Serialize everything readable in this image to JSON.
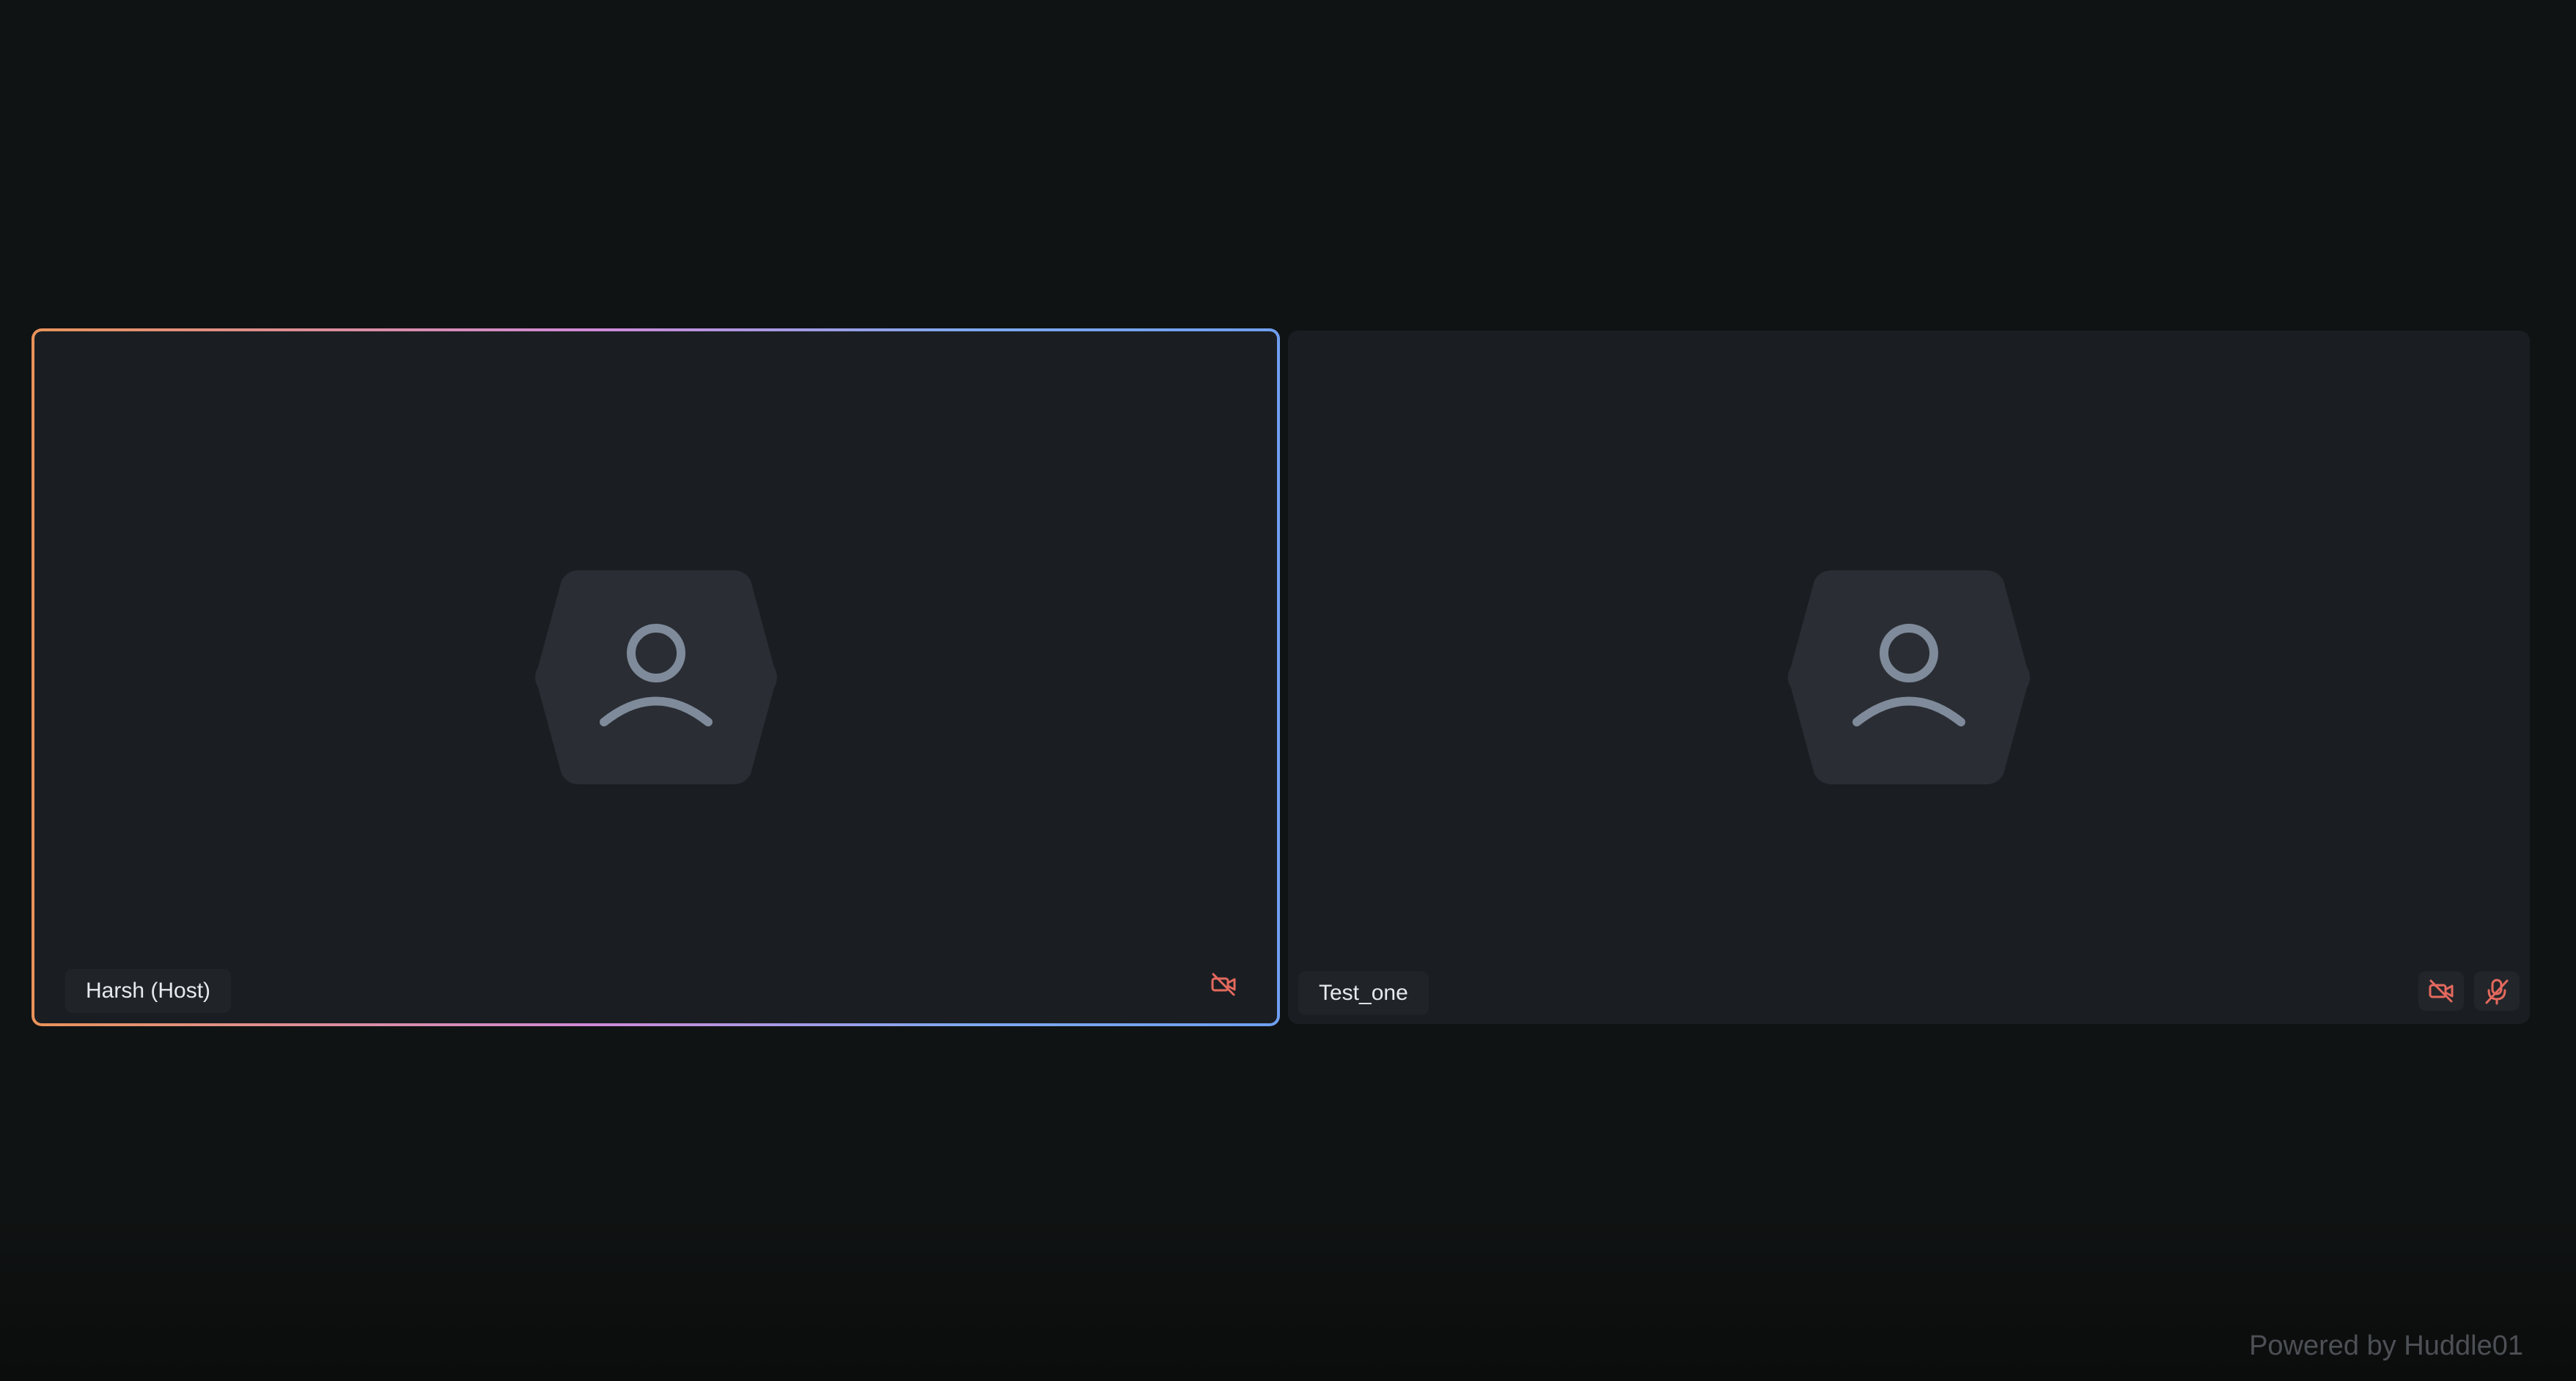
{
  "participants": [
    {
      "name": "Harsh (Host)",
      "active_speaker": true,
      "camera": "off",
      "microphone": "on",
      "avatar_icon": "user-icon"
    },
    {
      "name": "Test_one",
      "active_speaker": false,
      "camera": "off",
      "microphone": "off",
      "avatar_icon": "user-icon"
    }
  ],
  "icons": {
    "camera_off": "video-off-icon",
    "mic_off": "mic-off-icon"
  },
  "colors": {
    "background": "#101313",
    "tile": "#1a1e22",
    "avatar_fill": "#2a2e34",
    "avatar_stroke": "#7f8a9a",
    "status_red": "#e5695e",
    "speaker_border_start": "#e9935a",
    "speaker_border_end": "#6f9ff0"
  },
  "footer": {
    "powered_by": "Powered by Huddle01"
  }
}
